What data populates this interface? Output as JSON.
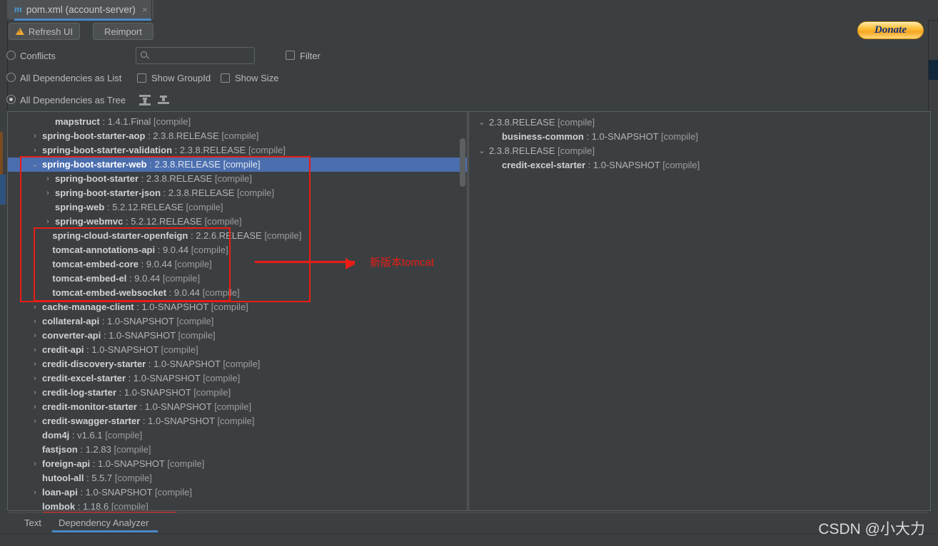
{
  "window": {
    "tab": {
      "icon": "maven-icon",
      "label": "pom.xml (account-server)",
      "close": "×"
    }
  },
  "toolbar": {
    "refresh_label": "Refresh UI",
    "reimport_label": "Reimport",
    "donate_label": "Donate"
  },
  "options": {
    "conflicts": {
      "label": "Conflicts",
      "selected": false
    },
    "all_as_list": {
      "label": "All Dependencies as List",
      "selected": false
    },
    "all_as_tree": {
      "label": "All Dependencies as Tree",
      "selected": true
    },
    "show_groupid": {
      "label": "Show GroupId",
      "checked": false
    },
    "show_size": {
      "label": "Show Size",
      "checked": false
    },
    "filter": {
      "label": "Filter",
      "checked": false
    },
    "expand_all_icon": "expand-all-icon",
    "collapse_all_icon": "collapse-all-icon"
  },
  "search": {
    "value": "",
    "placeholder": "",
    "icon": "search-icon"
  },
  "left_tree": {
    "rows": [
      {
        "indent": 2,
        "arrow": "",
        "artifact": "mapstruct",
        "version": "1.4.1.Final",
        "scope": "[compile]",
        "selected": false
      },
      {
        "indent": 1,
        "arrow": "›",
        "artifact": "spring-boot-starter-aop",
        "version": "2.3.8.RELEASE",
        "scope": "[compile]",
        "selected": false
      },
      {
        "indent": 1,
        "arrow": "›",
        "artifact": "spring-boot-starter-validation",
        "version": "2.3.8.RELEASE",
        "scope": "[compile]",
        "selected": false
      },
      {
        "indent": 1,
        "arrow": "⌄",
        "artifact": "spring-boot-starter-web",
        "version": "2.3.8.RELEASE",
        "scope": "[compile]",
        "selected": true
      },
      {
        "indent": 2,
        "arrow": "›",
        "artifact": "spring-boot-starter",
        "version": "2.3.8.RELEASE",
        "scope": "[compile]",
        "selected": false
      },
      {
        "indent": 2,
        "arrow": "›",
        "artifact": "spring-boot-starter-json",
        "version": "2.3.8.RELEASE",
        "scope": "[compile]",
        "selected": false
      },
      {
        "indent": 2,
        "arrow": "",
        "artifact": "spring-web",
        "version": "5.2.12.RELEASE",
        "scope": "[compile]",
        "selected": false
      },
      {
        "indent": 2,
        "arrow": "›",
        "artifact": "spring-webmvc",
        "version": "5.2.12.RELEASE",
        "scope": "[compile]",
        "selected": false
      },
      {
        "indent": 1.8,
        "arrow": "",
        "artifact": "spring-cloud-starter-openfeign",
        "version": "2.2.6.RELEASE",
        "scope": "[compile]",
        "selected": false
      },
      {
        "indent": 1.8,
        "arrow": "",
        "artifact": "tomcat-annotations-api",
        "version": "9.0.44",
        "scope": "[compile]",
        "selected": false
      },
      {
        "indent": 1.8,
        "arrow": "",
        "artifact": "tomcat-embed-core",
        "version": "9.0.44",
        "scope": "[compile]",
        "selected": false
      },
      {
        "indent": 1.8,
        "arrow": "",
        "artifact": "tomcat-embed-el",
        "version": "9.0.44",
        "scope": "[compile]",
        "selected": false
      },
      {
        "indent": 1.8,
        "arrow": "",
        "artifact": "tomcat-embed-websocket",
        "version": "9.0.44",
        "scope": "[compile]",
        "selected": false
      },
      {
        "indent": 1,
        "arrow": "›",
        "artifact": "cache-manage-client",
        "version": "1.0-SNAPSHOT",
        "scope": "[compile]",
        "selected": false
      },
      {
        "indent": 1,
        "arrow": "›",
        "artifact": "collateral-api",
        "version": "1.0-SNAPSHOT",
        "scope": "[compile]",
        "selected": false
      },
      {
        "indent": 1,
        "arrow": "›",
        "artifact": "converter-api",
        "version": "1.0-SNAPSHOT",
        "scope": "[compile]",
        "selected": false
      },
      {
        "indent": 1,
        "arrow": "›",
        "artifact": "credit-api",
        "version": "1.0-SNAPSHOT",
        "scope": "[compile]",
        "selected": false
      },
      {
        "indent": 1,
        "arrow": "›",
        "artifact": "credit-discovery-starter",
        "version": "1.0-SNAPSHOT",
        "scope": "[compile]",
        "selected": false
      },
      {
        "indent": 1,
        "arrow": "›",
        "artifact": "credit-excel-starter",
        "version": "1.0-SNAPSHOT",
        "scope": "[compile]",
        "selected": false
      },
      {
        "indent": 1,
        "arrow": "›",
        "artifact": "credit-log-starter",
        "version": "1.0-SNAPSHOT",
        "scope": "[compile]",
        "selected": false
      },
      {
        "indent": 1,
        "arrow": "›",
        "artifact": "credit-monitor-starter",
        "version": "1.0-SNAPSHOT",
        "scope": "[compile]",
        "selected": false
      },
      {
        "indent": 1,
        "arrow": "›",
        "artifact": "credit-swagger-starter",
        "version": "1.0-SNAPSHOT",
        "scope": "[compile]",
        "selected": false
      },
      {
        "indent": 1,
        "arrow": "",
        "artifact": "dom4j",
        "version": "v1.6.1",
        "scope": "[compile]",
        "selected": false
      },
      {
        "indent": 1,
        "arrow": "",
        "artifact": "fastjson",
        "version": "1.2.83",
        "scope": "[compile]",
        "selected": false
      },
      {
        "indent": 1,
        "arrow": "›",
        "artifact": "foreign-api",
        "version": "1.0-SNAPSHOT",
        "scope": "[compile]",
        "selected": false
      },
      {
        "indent": 1,
        "arrow": "",
        "artifact": "hutool-all",
        "version": "5.5.7",
        "scope": "[compile]",
        "selected": false
      },
      {
        "indent": 1,
        "arrow": "›",
        "artifact": "loan-api",
        "version": "1.0-SNAPSHOT",
        "scope": "[compile]",
        "selected": false
      },
      {
        "indent": 1,
        "arrow": "",
        "artifact": "lombok",
        "version": "1.18.6",
        "scope": "[compile]",
        "selected": false
      }
    ]
  },
  "right_tree": {
    "rows": [
      {
        "indent": 0,
        "arrow": "⌄",
        "artifact": "",
        "version": "2.3.8.RELEASE",
        "scope": "[compile]",
        "selected": false
      },
      {
        "indent": 1,
        "arrow": "",
        "artifact": "business-common",
        "version": "1.0-SNAPSHOT",
        "scope": "[compile]",
        "selected": false
      },
      {
        "indent": 0,
        "arrow": "⌄",
        "artifact": "",
        "version": "2.3.8.RELEASE",
        "scope": "[compile]",
        "selected": false
      },
      {
        "indent": 1,
        "arrow": "",
        "artifact": "credit-excel-starter",
        "version": "1.0-SNAPSHOT",
        "scope": "[compile]",
        "selected": false
      }
    ]
  },
  "annotation": {
    "text": "新版本tomcat",
    "color": "#e81d16"
  },
  "bottom_tabs": {
    "text_label": "Text",
    "dependency_analyzer_label": "Dependency Analyzer",
    "active": "Dependency Analyzer"
  },
  "watermark": {
    "text": "CSDN @小大力"
  }
}
